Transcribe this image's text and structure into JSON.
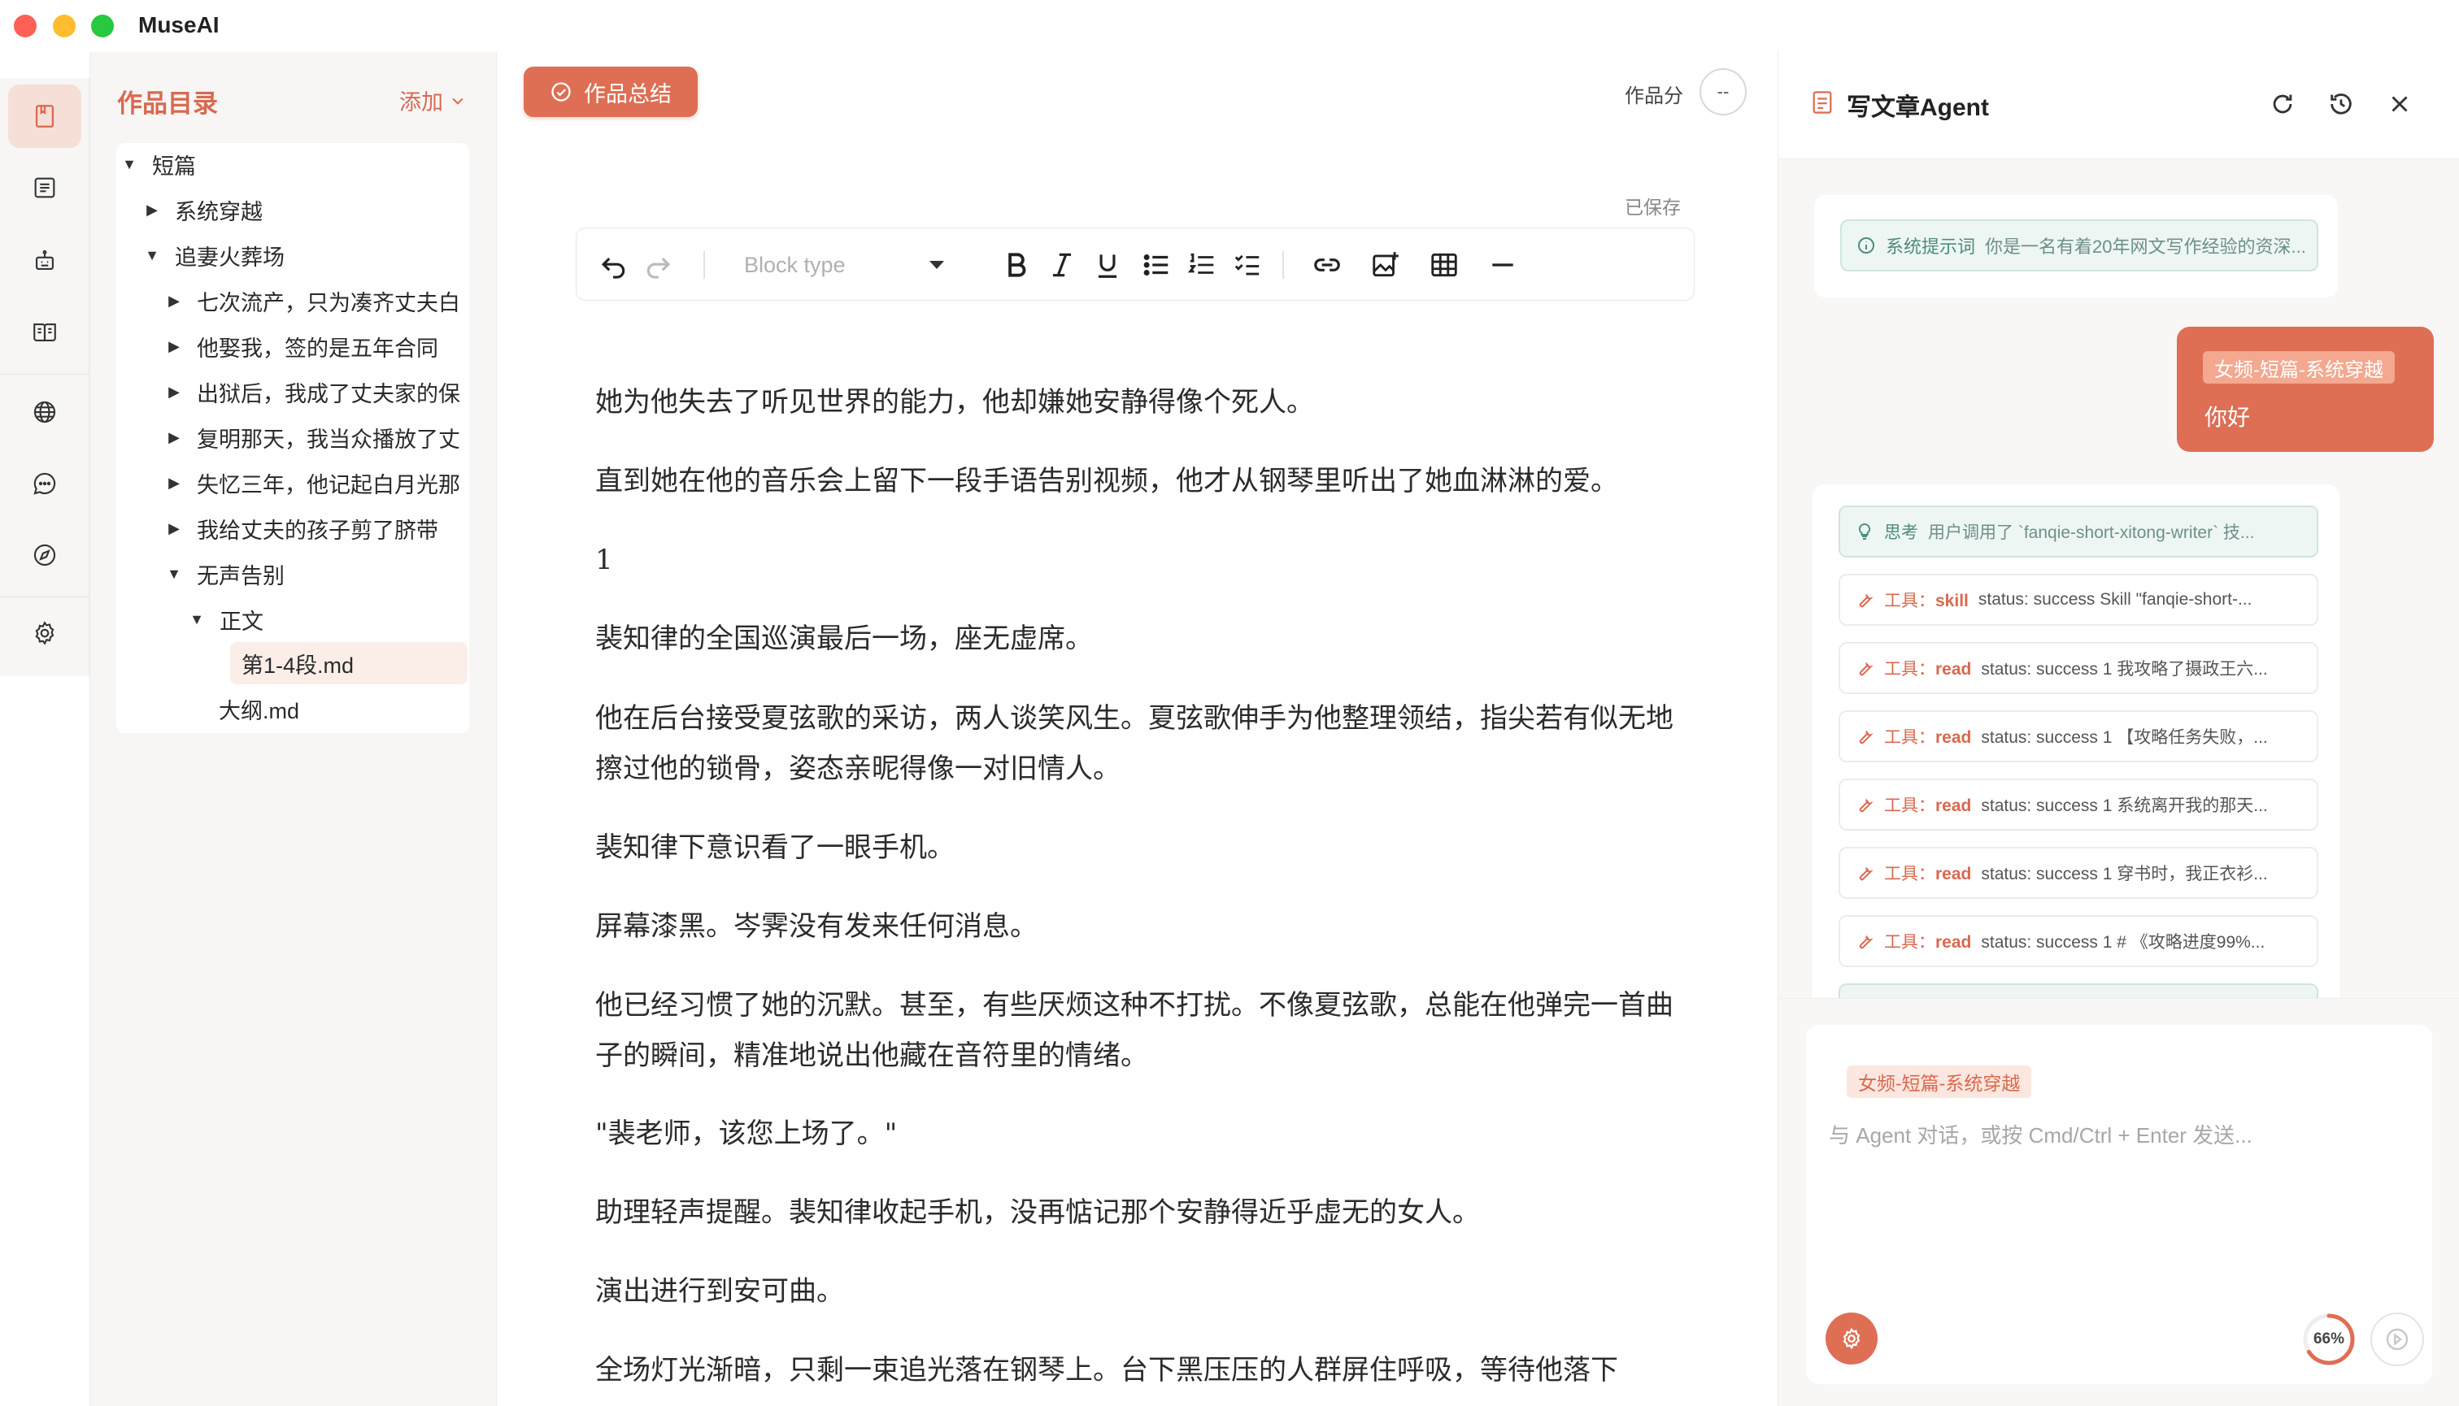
{
  "window": {
    "title": "MuseAI"
  },
  "sidebar": {
    "items": [
      {
        "name": "works",
        "icon": "book-open-icon",
        "active": true
      },
      {
        "name": "outline",
        "icon": "list-icon"
      },
      {
        "name": "character",
        "icon": "robot-icon"
      },
      {
        "name": "reader",
        "icon": "book-icon"
      },
      {
        "name": "web",
        "icon": "globe-icon"
      },
      {
        "name": "chat",
        "icon": "chat-icon"
      },
      {
        "name": "explore",
        "icon": "compass-icon"
      },
      {
        "name": "settings",
        "icon": "gear-icon"
      }
    ]
  },
  "tree": {
    "title": "作品目录",
    "add_label": "添加",
    "items": [
      {
        "label": "短篇",
        "depth": 0,
        "caret": "down"
      },
      {
        "label": "系统穿越",
        "depth": 1,
        "caret": "right"
      },
      {
        "label": "追妻火葬场",
        "depth": 1,
        "caret": "down"
      },
      {
        "label": "七次流产，只为凑齐丈夫白",
        "depth": 2,
        "caret": "right"
      },
      {
        "label": "他娶我，签的是五年合同",
        "depth": 2,
        "caret": "right"
      },
      {
        "label": "出狱后，我成了丈夫家的保",
        "depth": 2,
        "caret": "right"
      },
      {
        "label": "复明那天，我当众播放了丈",
        "depth": 2,
        "caret": "right"
      },
      {
        "label": "失忆三年，他记起白月光那",
        "depth": 2,
        "caret": "right"
      },
      {
        "label": "我给丈夫的孩子剪了脐带",
        "depth": 2,
        "caret": "right"
      },
      {
        "label": "无声告别",
        "depth": 2,
        "caret": "down"
      },
      {
        "label": "正文",
        "depth": 3,
        "caret": "down"
      },
      {
        "label": "第1-4段.md",
        "depth": 4,
        "caret": "none",
        "selected": true
      },
      {
        "label": "大纲.md",
        "depth": 3,
        "caret": "none"
      }
    ]
  },
  "editor": {
    "summary_button": "作品总结",
    "score_label": "作品分",
    "score_value": "--",
    "saved_label": "已保存",
    "toolbar": {
      "block_type_placeholder": "Block type",
      "tools": [
        "undo-icon",
        "redo-icon",
        "bold-icon",
        "italic-icon",
        "underline-icon",
        "bullet-list-icon",
        "numbered-list-icon",
        "checklist-icon",
        "link-icon",
        "image-icon",
        "table-icon",
        "horizontal-rule-icon"
      ]
    },
    "paragraphs": [
      "她为他失去了听见世界的能力，他却嫌她安静得像个死人。",
      "直到她在他的音乐会上留下一段手语告别视频，他才从钢琴里听出了她血淋淋的爱。",
      "1",
      "裴知律的全国巡演最后一场，座无虚席。",
      "他在后台接受夏弦歌的采访，两人谈笑风生。夏弦歌伸手为他整理领结，指尖若有似无地擦过他的锁骨，姿态亲昵得像一对旧情人。",
      "裴知律下意识看了一眼手机。",
      "屏幕漆黑。岑霁没有发来任何消息。",
      "他已经习惯了她的沉默。甚至，有些厌烦这种不打扰。不像夏弦歌，总能在他弹完一首曲子的瞬间，精准地说出他藏在音符里的情绪。",
      "\"裴老师，该您上场了。\"",
      "助理轻声提醒。裴知律收起手机，没再惦记那个安静得近乎虚无的女人。",
      "演出进行到安可曲。",
      "全场灯光渐暗，只剩一束追光落在钢琴上。台下黑压压的人群屏住呼吸，等待他落下"
    ]
  },
  "agent": {
    "title": "写文章Agent",
    "system_prompt": {
      "label": "系统提示词",
      "text": "你是一名有着20年网文写作经验的资深..."
    },
    "user_message": {
      "tag": "女频-短篇-系统穿越",
      "text": "你好"
    },
    "steps": [
      {
        "kind": "think",
        "label": "思考",
        "text": "用户调用了 `fanqie-short-xitong-writer` 技..."
      },
      {
        "kind": "tool",
        "label": "工具：",
        "tool": "skill",
        "text": "status: success Skill \"fanqie-short-..."
      },
      {
        "kind": "tool",
        "label": "工具：",
        "tool": "read",
        "text": "status: success 1 我攻略了摄政王六..."
      },
      {
        "kind": "tool",
        "label": "工具：",
        "tool": "read",
        "text": "status: success 1 【攻略任务失败，..."
      },
      {
        "kind": "tool",
        "label": "工具：",
        "tool": "read",
        "text": "status: success 1 系统离开我的那天..."
      },
      {
        "kind": "tool",
        "label": "工具：",
        "tool": "read",
        "text": "status: success 1 穿书时，我正衣衫..."
      },
      {
        "kind": "tool",
        "label": "工具：",
        "tool": "read",
        "text": "status: success 1 # 《攻略进度99%..."
      }
    ],
    "input": {
      "tag": "女频-短篇-系统穿越",
      "placeholder": "与 Agent 对话，或按 Cmd/Ctrl + Enter 发送...",
      "context_usage": "66%",
      "context_fraction": 0.66
    },
    "colors": {
      "accent": "#de6f55",
      "teal": "#4c8b7c"
    }
  }
}
